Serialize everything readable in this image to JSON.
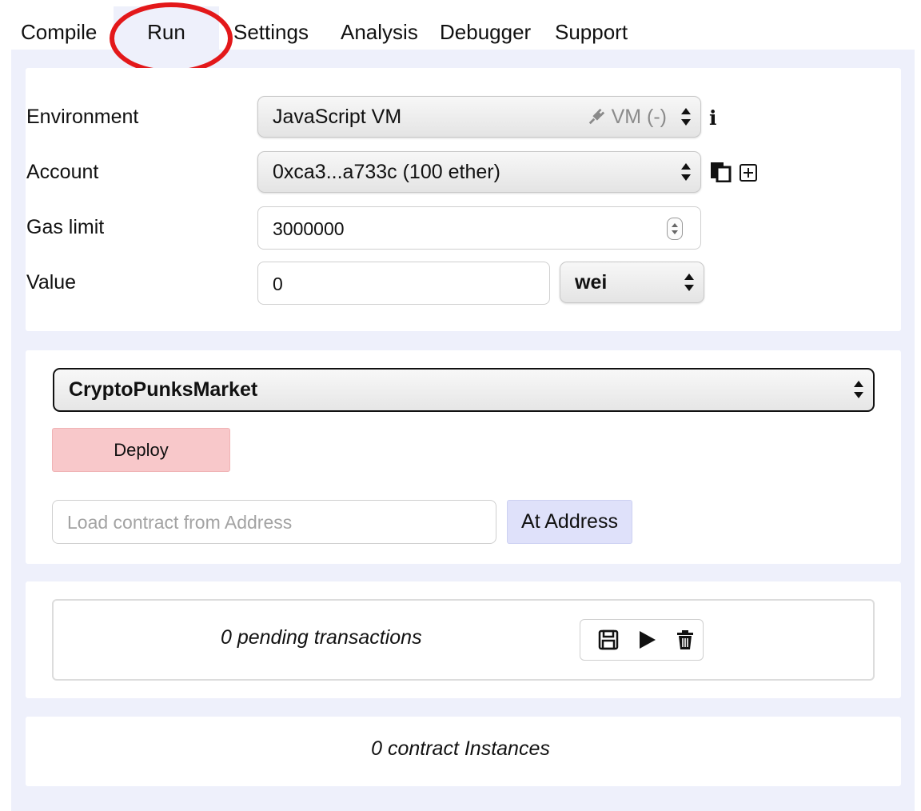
{
  "tabs": [
    {
      "label": "Compile"
    },
    {
      "label": "Run",
      "active": true
    },
    {
      "label": "Settings"
    },
    {
      "label": "Analysis"
    },
    {
      "label": "Debugger"
    },
    {
      "label": "Support"
    }
  ],
  "settings": {
    "environment": {
      "label": "Environment",
      "value": "JavaScript VM",
      "tag": "VM (-)"
    },
    "account": {
      "label": "Account",
      "value": "0xca3...a733c (100 ether)"
    },
    "gas_limit": {
      "label": "Gas limit",
      "value": "3000000"
    },
    "value": {
      "label": "Value",
      "amount": "0",
      "unit": "wei"
    }
  },
  "deploy": {
    "contract": "CryptoPunksMarket",
    "deploy_label": "Deploy",
    "address_placeholder": "Load contract from Address",
    "at_address_label": "At Address"
  },
  "pending": {
    "text": "0 pending transactions"
  },
  "instances": {
    "text": "0 contract Instances"
  },
  "colors": {
    "panel_bg": "#eef0fb",
    "deploy_bg": "#f8c8ca",
    "at_address_bg": "#dfe1fa",
    "highlight_ring": "#e3181a"
  },
  "icons": [
    "plug-icon",
    "info-icon",
    "copy-icon",
    "plus-icon",
    "save-icon",
    "play-icon",
    "trash-icon"
  ]
}
